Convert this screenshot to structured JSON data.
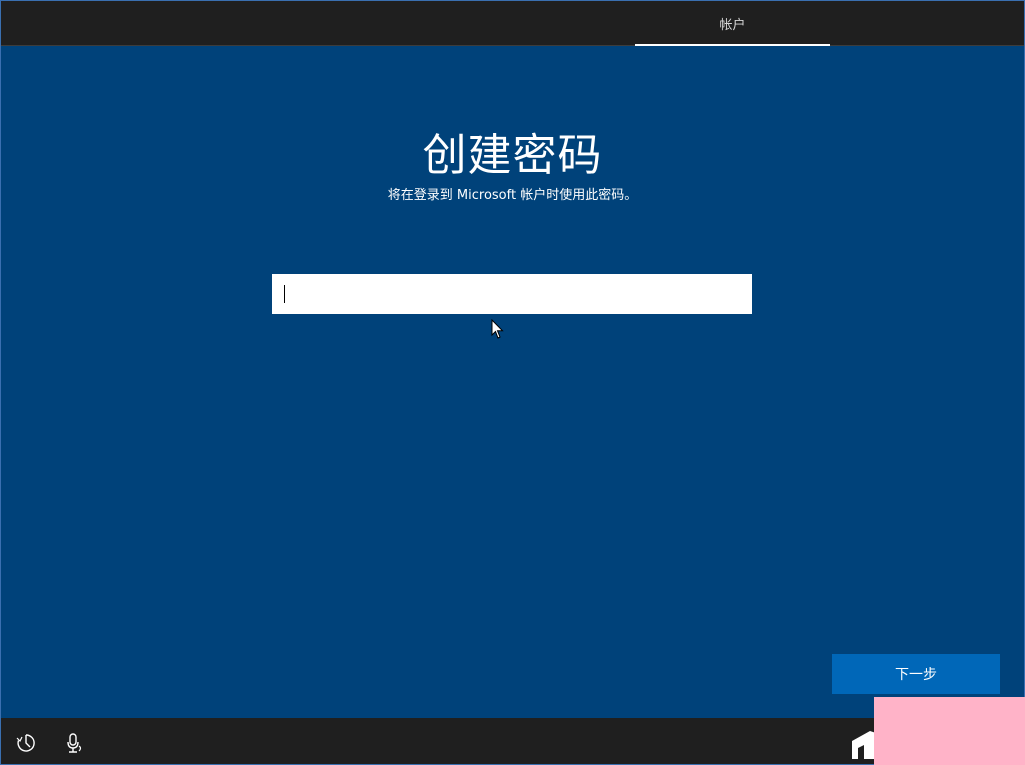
{
  "header": {
    "active_tab_label": "帐户"
  },
  "main": {
    "title": "创建密码",
    "subtitle": "将在登录到 Microsoft 帐户时使用此密码。",
    "password_field": {
      "value": "",
      "placeholder": ""
    }
  },
  "footer": {
    "next_label": "下一步",
    "icons": [
      "ease-of-access-icon",
      "microphone-icon",
      "logo-icon"
    ]
  },
  "colors": {
    "background": "#00427a",
    "bar": "#1f1f1f",
    "button": "#0067b8",
    "overlay": "#ffb3c8"
  }
}
